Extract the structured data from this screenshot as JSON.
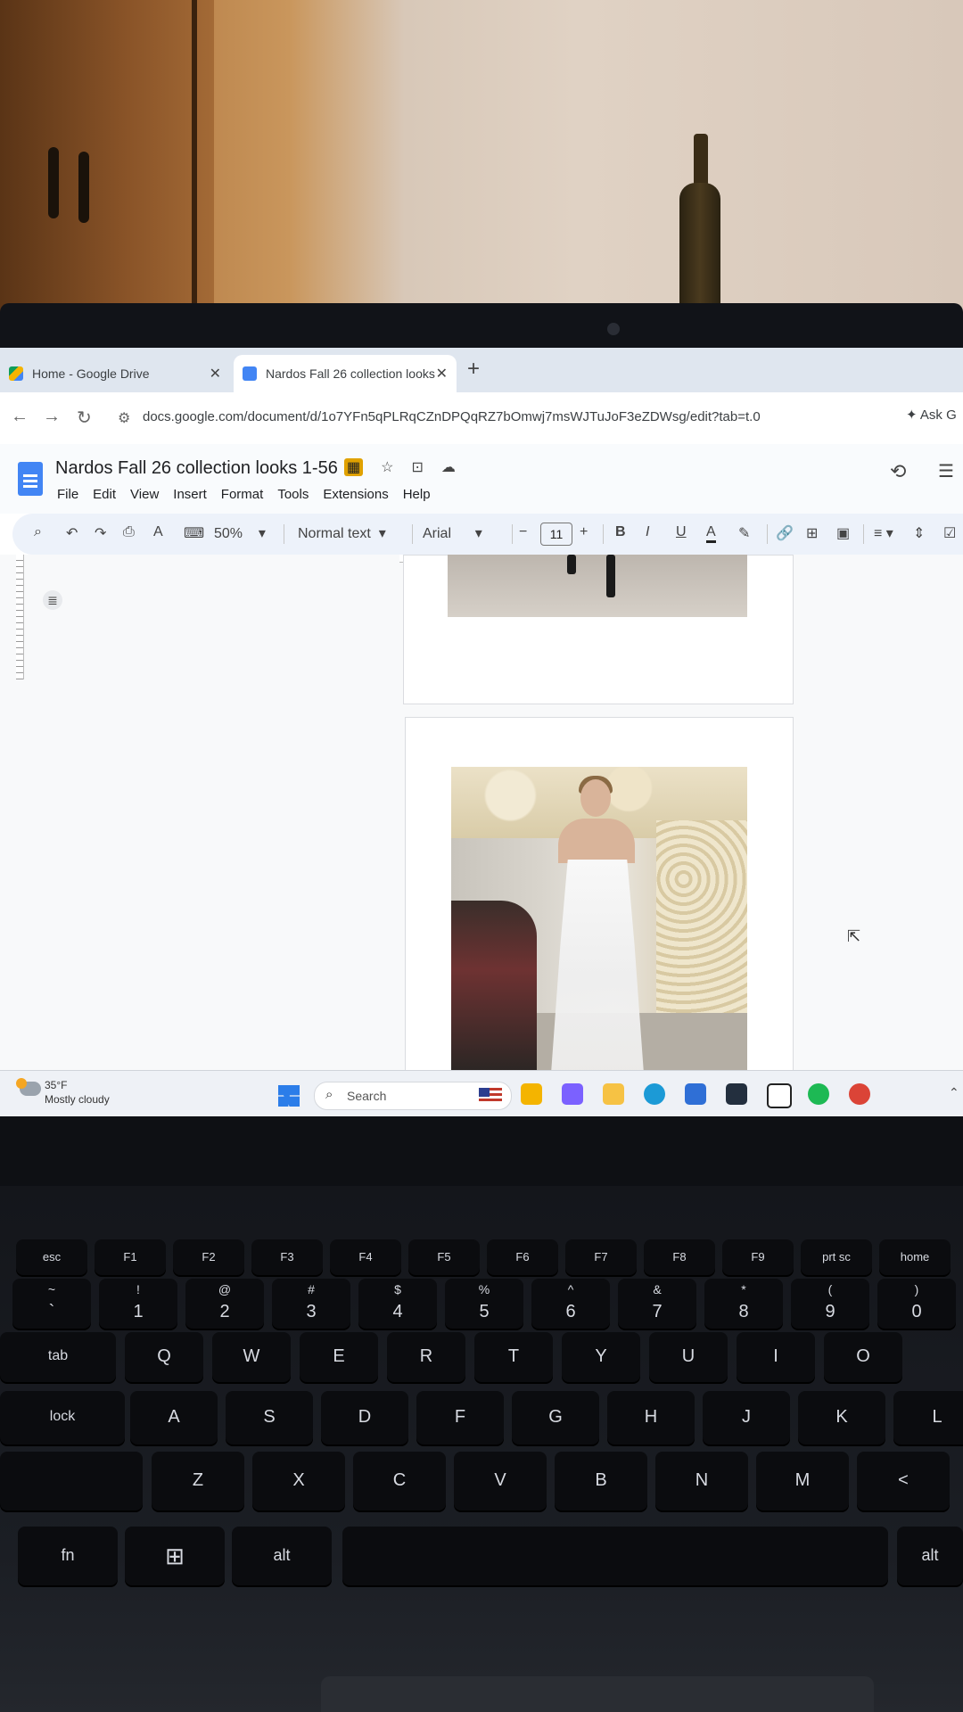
{
  "browser": {
    "tabs": [
      {
        "label": "Home - Google Drive",
        "active": false
      },
      {
        "label": "Nardos Fall 26 collection looks",
        "active": true
      }
    ],
    "new_tab": "+",
    "url": "docs.google.com/document/d/1o7YFn5qPLRqCZnDPQqRZ7bOmwj7msWJTuJoF3eZDWsg/edit?tab=t.0",
    "ask_label": "Ask G"
  },
  "docs": {
    "title": "Nardos Fall 26 collection looks 1-56",
    "menu": [
      "File",
      "Edit",
      "View",
      "Insert",
      "Format",
      "Tools",
      "Extensions",
      "Help"
    ],
    "toolbar": {
      "zoom": "50%",
      "style": "Normal text",
      "font": "Arial",
      "font_size": "11",
      "bold": "B",
      "italic": "I",
      "underline": "U",
      "text_color": "A"
    }
  },
  "taskbar": {
    "weather_temp": "35°F",
    "weather_desc": "Mostly cloudy",
    "search_placeholder": "Search",
    "apps": [
      {
        "icon": "file-manager-icon",
        "color": "#f4b400"
      },
      {
        "icon": "copilot-icon",
        "color": "#7b61ff"
      },
      {
        "icon": "folder-icon",
        "color": "#f6c244"
      },
      {
        "icon": "edge-icon",
        "color": "#1c9ad6"
      },
      {
        "icon": "store-icon",
        "color": "#2f6fd6"
      },
      {
        "icon": "amazon-icon",
        "color": "#232f3e"
      },
      {
        "icon": "notion-icon",
        "color": "#ffffff"
      },
      {
        "icon": "spotify-icon",
        "color": "#1db954"
      },
      {
        "icon": "chrome-icon",
        "color": "#db4437"
      }
    ]
  },
  "keyboard": {
    "row_fn": [
      "esc",
      "F1",
      "F2",
      "F3",
      "F4",
      "F5",
      "F6",
      "F7",
      "F8",
      "F9",
      "prt sc",
      "home"
    ],
    "row_num": [
      {
        "top": "~",
        "main": "`"
      },
      {
        "top": "!",
        "main": "1"
      },
      {
        "top": "@",
        "main": "2"
      },
      {
        "top": "#",
        "main": "3"
      },
      {
        "top": "$",
        "main": "4"
      },
      {
        "top": "%",
        "main": "5"
      },
      {
        "top": "^",
        "main": "6"
      },
      {
        "top": "&",
        "main": "7"
      },
      {
        "top": "*",
        "main": "8"
      },
      {
        "top": "(",
        "main": "9"
      },
      {
        "top": ")",
        "main": "0"
      }
    ],
    "row_q": [
      "tab",
      "Q",
      "W",
      "E",
      "R",
      "T",
      "Y",
      "U",
      "I",
      "O"
    ],
    "row_a": [
      "lock",
      "A",
      "S",
      "D",
      "F",
      "G",
      "H",
      "J",
      "K",
      "L"
    ],
    "row_z": [
      "Z",
      "X",
      "C",
      "V",
      "B",
      "N",
      "M",
      "<"
    ],
    "row_bottom": [
      "fn",
      "alt",
      "alt"
    ]
  }
}
